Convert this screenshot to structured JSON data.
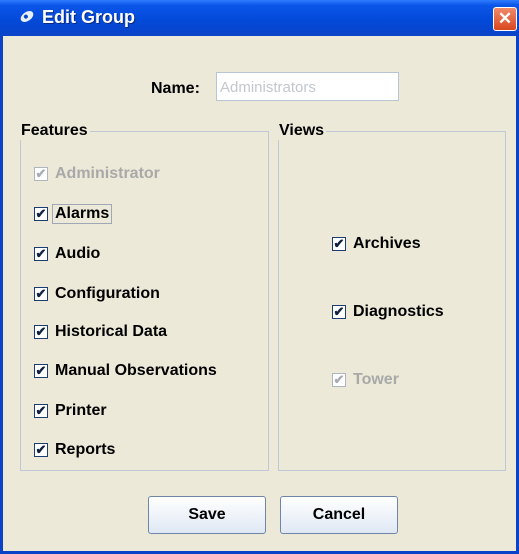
{
  "window": {
    "title": "Edit Group",
    "close_glyph": "✕"
  },
  "name": {
    "label": "Name:",
    "value": "Administrators"
  },
  "features": {
    "title": "Features",
    "items": [
      {
        "label": "Administrator",
        "checked": true,
        "enabled": false
      },
      {
        "label": "Alarms",
        "checked": true,
        "enabled": true,
        "focused": true
      },
      {
        "label": "Audio",
        "checked": true,
        "enabled": true
      },
      {
        "label": "Configuration",
        "checked": true,
        "enabled": true
      },
      {
        "label": "Historical Data",
        "checked": true,
        "enabled": true
      },
      {
        "label": "Manual Observations",
        "checked": true,
        "enabled": true
      },
      {
        "label": "Printer",
        "checked": true,
        "enabled": true
      },
      {
        "label": "Reports",
        "checked": true,
        "enabled": true
      }
    ]
  },
  "views": {
    "title": "Views",
    "items": [
      {
        "label": "Archives",
        "checked": true,
        "enabled": true
      },
      {
        "label": "Diagnostics",
        "checked": true,
        "enabled": true
      },
      {
        "label": "Tower",
        "checked": true,
        "enabled": false
      }
    ]
  },
  "buttons": {
    "save": "Save",
    "cancel": "Cancel"
  },
  "check_glyph": "✔"
}
